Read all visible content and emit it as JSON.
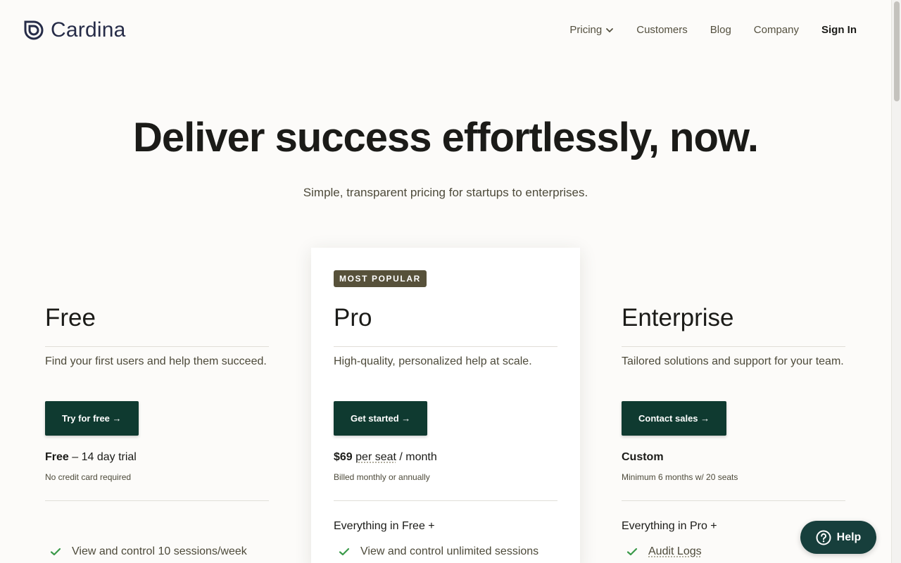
{
  "brand": {
    "name": "Cardina"
  },
  "nav": {
    "items": [
      {
        "label": "Pricing",
        "has_dropdown": true
      },
      {
        "label": "Customers"
      },
      {
        "label": "Blog"
      },
      {
        "label": "Company"
      }
    ],
    "signin": "Sign In"
  },
  "hero": {
    "title": "Deliver success effortlessly, now.",
    "subtitle": "Simple, transparent pricing for startups to enterprises."
  },
  "plans": [
    {
      "name": "Free",
      "description": "Find your first users and help them succeed.",
      "cta": "Try for free →",
      "price_bold": "Free",
      "price_rest": " – 14 day trial",
      "price_note": "No credit card required",
      "everything": "",
      "feature": "View and control 10 sessions/week"
    },
    {
      "badge": "MOST POPULAR",
      "name": "Pro",
      "description": "High-quality, personalized help at scale.",
      "cta": "Get started →",
      "price_bold": "$69",
      "price_per": "per seat",
      "price_rest": " / month",
      "price_note": "Billed monthly or annually",
      "everything": "Everything in Free +",
      "feature": "View and control unlimited sessions"
    },
    {
      "name": "Enterprise",
      "description": "Tailored solutions and support for your team.",
      "cta": "Contact sales →",
      "price_bold": "Custom",
      "price_rest": "",
      "price_note": "Minimum 6 months w/ 20 seats",
      "everything": "Everything in Pro +",
      "feature": "Audit Logs"
    }
  ],
  "help": {
    "label": "Help"
  },
  "colors": {
    "accent": "#0f3a30",
    "badge": "#57513a",
    "check": "#3a9a4a",
    "help": "#173f3c"
  }
}
